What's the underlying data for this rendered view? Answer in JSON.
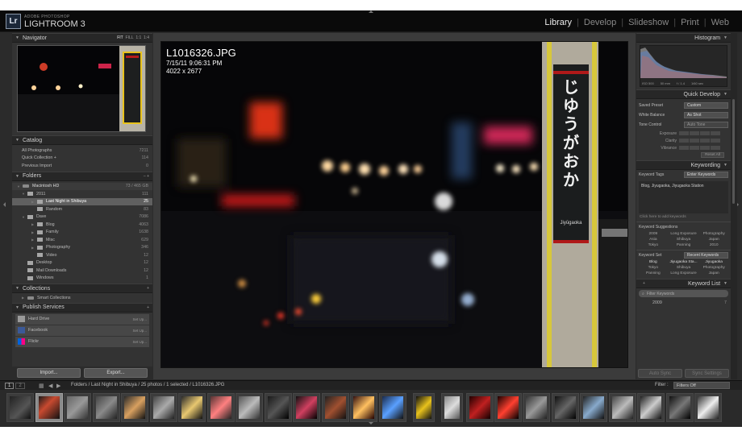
{
  "header": {
    "adobe_label": "ADOBE PHOTOSHOP",
    "product_label": "LIGHTROOM 3",
    "logo_text": "Lr",
    "modules": [
      "Library",
      "Develop",
      "Slideshow",
      "Print",
      "Web"
    ],
    "active_module": "Library"
  },
  "navigator": {
    "title": "Navigator",
    "zoom_options": [
      "FIT",
      "FILL",
      "1:1",
      "1:4"
    ]
  },
  "catalog": {
    "title": "Catalog",
    "items": [
      {
        "label": "All Photographs",
        "count": "7211"
      },
      {
        "label": "Quick Collection +",
        "count": "114"
      },
      {
        "label": "Previous Import",
        "count": "0"
      }
    ]
  },
  "folders": {
    "title": "Folders",
    "controls": "– +",
    "volume": {
      "label": "Macintosh HD",
      "info": "73 / 465 GB"
    },
    "items": [
      {
        "label": "2011",
        "count": "111",
        "level": 1,
        "open": true
      },
      {
        "label": "Last Night in Shibuya",
        "count": "25",
        "level": 2,
        "selected": true
      },
      {
        "label": "Random",
        "count": "83",
        "level": 2
      },
      {
        "label": "Dave",
        "count": "7086",
        "level": 1,
        "open": true
      },
      {
        "label": "Blog",
        "count": "4063",
        "level": 2
      },
      {
        "label": "Family",
        "count": "1638",
        "level": 2
      },
      {
        "label": "Misc",
        "count": "629",
        "level": 2
      },
      {
        "label": "Photography",
        "count": "346",
        "level": 2
      },
      {
        "label": "Video",
        "count": "12",
        "level": 2
      },
      {
        "label": "Desktop",
        "count": "12",
        "level": 1
      },
      {
        "label": "Mail Downloads",
        "count": "12",
        "level": 1
      },
      {
        "label": "Windows",
        "count": "1",
        "level": 1
      }
    ]
  },
  "collections": {
    "title": "Collections",
    "items": [
      {
        "label": "Smart Collections"
      }
    ]
  },
  "publish": {
    "title": "Publish Services",
    "items": [
      {
        "label": "Hard Drive",
        "action": "Set Up...",
        "color": "#9a9a9a"
      },
      {
        "label": "Facebook",
        "action": "Set Up...",
        "color": "#3b5998"
      },
      {
        "label": "Flickr",
        "action": "Set Up...",
        "color": "#ff0084"
      }
    ]
  },
  "left_buttons": {
    "import": "Import...",
    "export": "Export..."
  },
  "photo": {
    "filename": "L1016326.JPG",
    "datetime": "7/15/11 9:06:31 PM",
    "dimensions": "4022 x 2677",
    "sign_text": "じゆうがおか",
    "sign_romaji": "Jiyūgaoka"
  },
  "histogram": {
    "title": "Histogram",
    "readout": [
      "ISO 500",
      "50 mm",
      "f / 1.4",
      "1/60 sec"
    ]
  },
  "quick_develop": {
    "title": "Quick Develop",
    "saved_preset": {
      "label": "Saved Preset",
      "value": "Custom"
    },
    "white_balance": {
      "label": "White Balance",
      "value": "As Shot"
    },
    "tone_control": {
      "label": "Tone Control",
      "value": "Auto Tone"
    },
    "sliders": [
      "Exposure",
      "Clarity",
      "Vibrance"
    ],
    "reset": "Reset All"
  },
  "keywording": {
    "title": "Keywording",
    "keyword_tags": {
      "label": "Keyword Tags",
      "value": "Enter Keywords"
    },
    "tags": "Blog, Jiyugaoka, Jiyugaoka Station",
    "add_hint": "Click here to add keywords",
    "suggestions_label": "Keyword Suggestions",
    "suggestions": [
      "2009",
      "Long Exposure",
      "Photography",
      "Asia",
      "Shibuya",
      "Japan",
      "Tokyo",
      "Panning",
      "2010"
    ],
    "set_label": "Keyword Set",
    "set_value": "Recent Keywords",
    "set_items": [
      "Blog",
      "Jiyugaoka Sta...",
      "Jiyugaoka",
      "Tokyo",
      "Shibuya",
      "Photography",
      "Panning",
      "Long Exposure",
      "Japan"
    ]
  },
  "keyword_list": {
    "title": "Keyword List",
    "filter_placeholder": "Filter Keywords",
    "items": [
      {
        "label": "2009",
        "count": "7"
      }
    ]
  },
  "right_buttons": {
    "sync": "Auto Sync",
    "settings": "Sync Settings"
  },
  "filmstrip": {
    "path": "Folders / Last Night in Shibuya / 25 photos / 1 selected / L1016326.JPG",
    "filter_label": "Filter :",
    "filter_value": "Filters Off",
    "page_buttons": [
      "1",
      "2"
    ]
  },
  "colors": {
    "accent_red": "#ff2a2a",
    "sign_yellow": "#e8c21c",
    "selected": "#606060"
  }
}
